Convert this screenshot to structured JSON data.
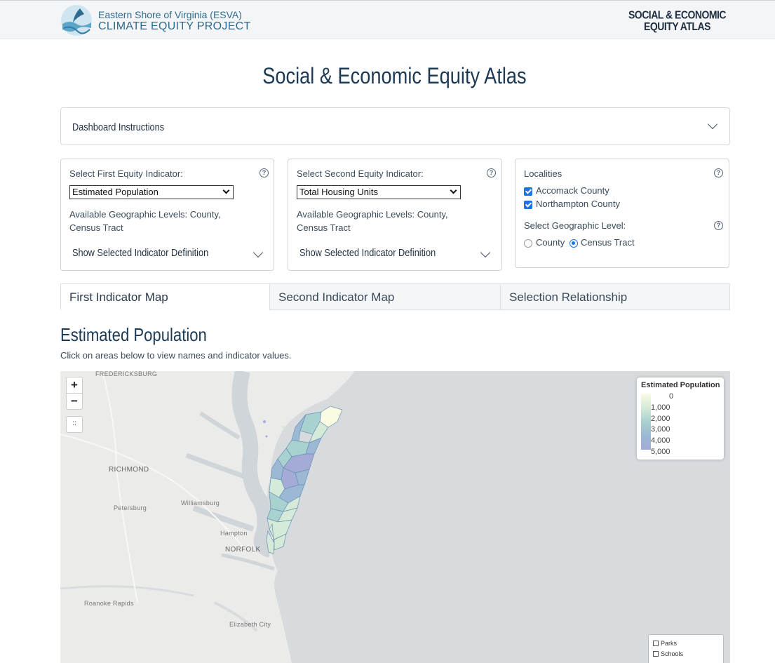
{
  "header": {
    "brand_line1": "Eastern Shore of Virginia (ESVA)",
    "brand_line2": "CLIMATE EQUITY PROJECT",
    "tag_line1": "SOCIAL & ECONOMIC",
    "tag_line2": "EQUITY ATLAS",
    "logo_icon": "esva-logo-icon"
  },
  "page_title": "Social & Economic Equity Atlas",
  "instructions": {
    "label": "Dashboard Instructions"
  },
  "first_indicator": {
    "label": "Select First Equity Indicator:",
    "selected": "Estimated Population",
    "available_line1": "Available Geographic Levels: County,",
    "available_line2": "Census Tract",
    "definition_toggle": "Show Selected Indicator Definition"
  },
  "second_indicator": {
    "label": "Select Second Equity Indicator:",
    "selected": "Total Housing Units",
    "available_line1": "Available Geographic Levels: County,",
    "available_line2": "Census Tract",
    "definition_toggle": "Show Selected Indicator Definition"
  },
  "localities": {
    "label": "Localities",
    "items": [
      {
        "label": "Accomack County",
        "checked": true
      },
      {
        "label": "Northampton County",
        "checked": true
      }
    ],
    "geo_level_label": "Select Geographic Level:",
    "geo_options": [
      {
        "label": "County",
        "selected": false
      },
      {
        "label": "Census Tract",
        "selected": true
      }
    ]
  },
  "help_glyph": "?",
  "tabs": [
    {
      "label": "First Indicator Map",
      "active": true
    },
    {
      "label": "Second Indicator Map",
      "active": false
    },
    {
      "label": "Selection Relationship",
      "active": false
    }
  ],
  "section": {
    "title": "Estimated Population",
    "subtitle": "Click on areas below to view names and indicator values."
  },
  "map": {
    "zoom_in": "+",
    "zoom_out": "−",
    "fullscreen": "::",
    "places": [
      "FREDERICKSBURG",
      "RICHMOND",
      "Petersburg",
      "Williamsburg",
      "Hampton",
      "NORFOLK",
      "Roanoke Rapids",
      "Elizabeth City"
    ],
    "legend": {
      "title": "Estimated Population",
      "ticks": [
        "0",
        "1,000",
        "2,000",
        "3,000",
        "4,000",
        "5,000"
      ],
      "colors": [
        "#fbfbe3",
        "#d5ebd7",
        "#a8d1cf",
        "#9bb9d4",
        "#a4abd6"
      ]
    },
    "layers": [
      "Parks",
      "Schools"
    ]
  }
}
